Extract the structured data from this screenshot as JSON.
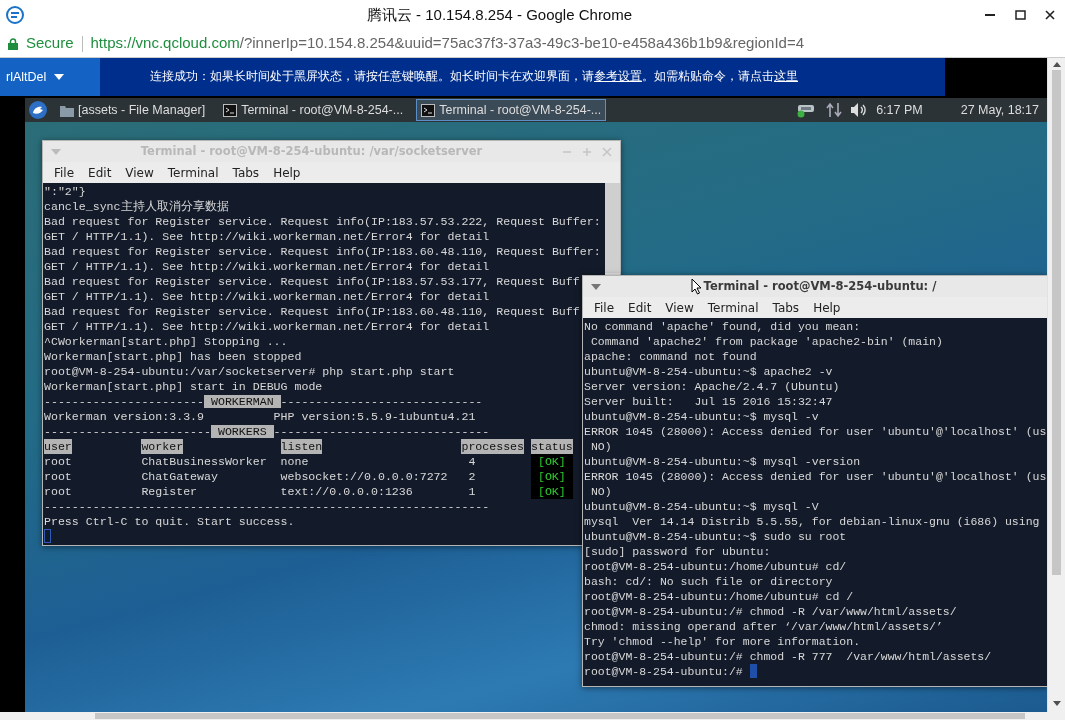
{
  "browser": {
    "title": "腾讯云 - 10.154.8.254 - Google Chrome",
    "security": "Secure",
    "url_host": "https://vnc.qcloud.com",
    "url_rest": "/?innerIp=10.154.8.254&uuid=75ac37f3-37a3-49c3-be10-e458a436b1b9&regionId=4"
  },
  "vnc_toolbar": {
    "menu": "rlAltDel",
    "notice": [
      {
        "text": "连接成功：如果长时间处于黑屏状态，请按任意键唤醒。如长时间卡在欢迎界面，请",
        "link": false
      },
      {
        "text": "参考设置",
        "link": true
      },
      {
        "text": "。如需粘贴命令，请点击",
        "link": false
      },
      {
        "text": "这里",
        "link": true
      }
    ]
  },
  "taskbar": {
    "tasks": [
      {
        "label": "[assets - File Manager]",
        "kind": "folder",
        "selected": false
      },
      {
        "label": "Terminal - root@VM-8-254-...",
        "kind": "terminal",
        "selected": false
      },
      {
        "label": "Terminal - root@VM-8-254-...",
        "kind": "terminal",
        "selected": true
      }
    ],
    "time": "6:17 PM",
    "date": "27 May, 18:17"
  },
  "windows": [
    {
      "title": "Terminal - root@VM-8-254-ubuntu: /var/socketserver",
      "active": false,
      "show_controls": true,
      "mouse_pointer": false,
      "cursor_new_line": true,
      "menu": [
        "File",
        "Edit",
        "View",
        "Terminal",
        "Tabs",
        "Help"
      ],
      "lines": [
        {
          "text": "\":\"2\"}"
        },
        {
          "text": "cancle_sync主持人取消分享数据"
        },
        {
          "text": "Bad request for Register service. Request info(IP:183.57.53.222, Request Buffer:"
        },
        {
          "text": "GET / HTTP/1.1). See http://wiki.workerman.net/Error4 for detail"
        },
        {
          "text": "Bad request for Register service. Request info(IP:183.60.48.110, Request Buffer:"
        },
        {
          "text": "GET / HTTP/1.1). See http://wiki.workerman.net/Error4 for detail"
        },
        {
          "text": "Bad request for Register service. Request info(IP:183.57.53.177, Request Buff"
        },
        {
          "text": "GET / HTTP/1.1). See http://wiki.workerman.net/Error4 for detail"
        },
        {
          "text": "Bad request for Register service. Request info(IP:183.60.48.110, Request Buff"
        },
        {
          "text": "GET / HTTP/1.1). See http://wiki.workerman.net/Error4 for detail"
        },
        {
          "text": "^CWorkerman[start.php] Stopping ..."
        },
        {
          "text": "Workerman[start.php] has been stopped"
        },
        {
          "text": "root@VM-8-254-ubuntu:/var/socketserver# php start.php start"
        },
        {
          "text": "Workerman[start.php] start in DEBUG mode"
        },
        {
          "kind": "banner",
          "left": "-----------------------",
          "label": "WORKERMAN",
          "right": "-----------------------------"
        },
        {
          "text": "Workerman version:3.3.9          PHP version:5.5.9-1ubuntu4.21"
        },
        {
          "kind": "banner",
          "left": "------------------------",
          "label": "WORKERS",
          "right": "-------------------------------"
        },
        {
          "kind": "table",
          "columns": [
            "user",
            "worker",
            "listen",
            "processes",
            "status"
          ],
          "rows": [
            [
              "root",
              "ChatBusinessWorker",
              "none",
              "4",
              "[OK]"
            ],
            [
              "root",
              "ChatGateway",
              "websocket://0.0.0.0:7272",
              "2",
              "[OK]"
            ],
            [
              "root",
              "Register",
              "text://0.0.0.0:1236",
              "1",
              "[OK]"
            ]
          ]
        },
        {
          "text": "----------------------------------------------------------------"
        },
        {
          "text": "Press Ctrl-C to quit. Start success."
        }
      ]
    },
    {
      "title": "Terminal - root@VM-8-254-ubuntu: /",
      "active": true,
      "show_controls": false,
      "mouse_pointer": true,
      "cursor_new_line": false,
      "menu": [
        "File",
        "Edit",
        "View",
        "Terminal",
        "Tabs",
        "Help"
      ],
      "lines": [
        {
          "text": "No command 'apache' found, did you mean:"
        },
        {
          "text": " Command 'apache2' from package 'apache2-bin' (main)"
        },
        {
          "text": "apache: command not found"
        },
        {
          "text": "ubuntu@VM-8-254-ubuntu:~$ apache2 -v"
        },
        {
          "text": "Server version: Apache/2.4.7 (Ubuntu)"
        },
        {
          "text": "Server built:   Jul 15 2016 15:32:47"
        },
        {
          "text": "ubuntu@VM-8-254-ubuntu:~$ mysql -v"
        },
        {
          "text": "ERROR 1045 (28000): Access denied for user 'ubuntu'@'localhost' (us"
        },
        {
          "text": " NO)"
        },
        {
          "text": "ubuntu@VM-8-254-ubuntu:~$ mysql -version"
        },
        {
          "text": "ERROR 1045 (28000): Access denied for user 'ubuntu'@'localhost' (us"
        },
        {
          "text": " NO)"
        },
        {
          "text": "ubuntu@VM-8-254-ubuntu:~$ mysql -V"
        },
        {
          "text": "mysql  Ver 14.14 Distrib 5.5.55, for debian-linux-gnu (i686) using"
        },
        {
          "text": "ubuntu@VM-8-254-ubuntu:~$ sudo su root"
        },
        {
          "text": "[sudo] password for ubuntu:"
        },
        {
          "text": "root@VM-8-254-ubuntu:/home/ubuntu# cd/"
        },
        {
          "text": "bash: cd/: No such file or directory"
        },
        {
          "text": "root@VM-8-254-ubuntu:/home/ubuntu# cd /"
        },
        {
          "text": "root@VM-8-254-ubuntu:/# chmod -R /var/www/html/assets/"
        },
        {
          "text": "chmod: missing operand after ‘/var/www/html/assets/’"
        },
        {
          "text": "Try 'chmod --help' for more information."
        },
        {
          "text": "root@VM-8-254-ubuntu:/# chmod -R 777  /var/www/html/assets/"
        },
        {
          "text": "root@VM-8-254-ubuntu:/#"
        }
      ]
    }
  ]
}
